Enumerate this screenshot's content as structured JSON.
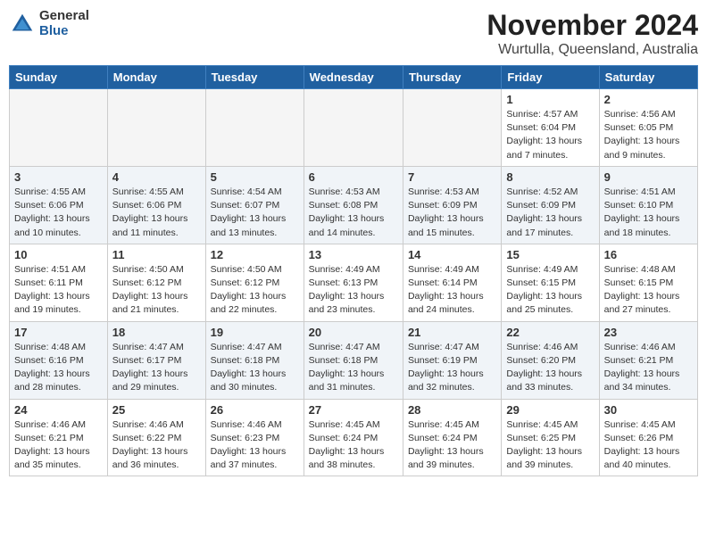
{
  "header": {
    "logo_general": "General",
    "logo_blue": "Blue",
    "month": "November 2024",
    "location": "Wurtulla, Queensland, Australia"
  },
  "weekdays": [
    "Sunday",
    "Monday",
    "Tuesday",
    "Wednesday",
    "Thursday",
    "Friday",
    "Saturday"
  ],
  "weeks": [
    [
      {
        "day": "",
        "info": ""
      },
      {
        "day": "",
        "info": ""
      },
      {
        "day": "",
        "info": ""
      },
      {
        "day": "",
        "info": ""
      },
      {
        "day": "",
        "info": ""
      },
      {
        "day": "1",
        "info": "Sunrise: 4:57 AM\nSunset: 6:04 PM\nDaylight: 13 hours\nand 7 minutes."
      },
      {
        "day": "2",
        "info": "Sunrise: 4:56 AM\nSunset: 6:05 PM\nDaylight: 13 hours\nand 9 minutes."
      }
    ],
    [
      {
        "day": "3",
        "info": "Sunrise: 4:55 AM\nSunset: 6:06 PM\nDaylight: 13 hours\nand 10 minutes."
      },
      {
        "day": "4",
        "info": "Sunrise: 4:55 AM\nSunset: 6:06 PM\nDaylight: 13 hours\nand 11 minutes."
      },
      {
        "day": "5",
        "info": "Sunrise: 4:54 AM\nSunset: 6:07 PM\nDaylight: 13 hours\nand 13 minutes."
      },
      {
        "day": "6",
        "info": "Sunrise: 4:53 AM\nSunset: 6:08 PM\nDaylight: 13 hours\nand 14 minutes."
      },
      {
        "day": "7",
        "info": "Sunrise: 4:53 AM\nSunset: 6:09 PM\nDaylight: 13 hours\nand 15 minutes."
      },
      {
        "day": "8",
        "info": "Sunrise: 4:52 AM\nSunset: 6:09 PM\nDaylight: 13 hours\nand 17 minutes."
      },
      {
        "day": "9",
        "info": "Sunrise: 4:51 AM\nSunset: 6:10 PM\nDaylight: 13 hours\nand 18 minutes."
      }
    ],
    [
      {
        "day": "10",
        "info": "Sunrise: 4:51 AM\nSunset: 6:11 PM\nDaylight: 13 hours\nand 19 minutes."
      },
      {
        "day": "11",
        "info": "Sunrise: 4:50 AM\nSunset: 6:12 PM\nDaylight: 13 hours\nand 21 minutes."
      },
      {
        "day": "12",
        "info": "Sunrise: 4:50 AM\nSunset: 6:12 PM\nDaylight: 13 hours\nand 22 minutes."
      },
      {
        "day": "13",
        "info": "Sunrise: 4:49 AM\nSunset: 6:13 PM\nDaylight: 13 hours\nand 23 minutes."
      },
      {
        "day": "14",
        "info": "Sunrise: 4:49 AM\nSunset: 6:14 PM\nDaylight: 13 hours\nand 24 minutes."
      },
      {
        "day": "15",
        "info": "Sunrise: 4:49 AM\nSunset: 6:15 PM\nDaylight: 13 hours\nand 25 minutes."
      },
      {
        "day": "16",
        "info": "Sunrise: 4:48 AM\nSunset: 6:15 PM\nDaylight: 13 hours\nand 27 minutes."
      }
    ],
    [
      {
        "day": "17",
        "info": "Sunrise: 4:48 AM\nSunset: 6:16 PM\nDaylight: 13 hours\nand 28 minutes."
      },
      {
        "day": "18",
        "info": "Sunrise: 4:47 AM\nSunset: 6:17 PM\nDaylight: 13 hours\nand 29 minutes."
      },
      {
        "day": "19",
        "info": "Sunrise: 4:47 AM\nSunset: 6:18 PM\nDaylight: 13 hours\nand 30 minutes."
      },
      {
        "day": "20",
        "info": "Sunrise: 4:47 AM\nSunset: 6:18 PM\nDaylight: 13 hours\nand 31 minutes."
      },
      {
        "day": "21",
        "info": "Sunrise: 4:47 AM\nSunset: 6:19 PM\nDaylight: 13 hours\nand 32 minutes."
      },
      {
        "day": "22",
        "info": "Sunrise: 4:46 AM\nSunset: 6:20 PM\nDaylight: 13 hours\nand 33 minutes."
      },
      {
        "day": "23",
        "info": "Sunrise: 4:46 AM\nSunset: 6:21 PM\nDaylight: 13 hours\nand 34 minutes."
      }
    ],
    [
      {
        "day": "24",
        "info": "Sunrise: 4:46 AM\nSunset: 6:21 PM\nDaylight: 13 hours\nand 35 minutes."
      },
      {
        "day": "25",
        "info": "Sunrise: 4:46 AM\nSunset: 6:22 PM\nDaylight: 13 hours\nand 36 minutes."
      },
      {
        "day": "26",
        "info": "Sunrise: 4:46 AM\nSunset: 6:23 PM\nDaylight: 13 hours\nand 37 minutes."
      },
      {
        "day": "27",
        "info": "Sunrise: 4:45 AM\nSunset: 6:24 PM\nDaylight: 13 hours\nand 38 minutes."
      },
      {
        "day": "28",
        "info": "Sunrise: 4:45 AM\nSunset: 6:24 PM\nDaylight: 13 hours\nand 39 minutes."
      },
      {
        "day": "29",
        "info": "Sunrise: 4:45 AM\nSunset: 6:25 PM\nDaylight: 13 hours\nand 39 minutes."
      },
      {
        "day": "30",
        "info": "Sunrise: 4:45 AM\nSunset: 6:26 PM\nDaylight: 13 hours\nand 40 minutes."
      }
    ]
  ],
  "colors": {
    "header_bg": "#2060a0",
    "row_odd": "#ffffff",
    "row_even": "#e8eef5",
    "empty_bg": "#f5f5f5"
  }
}
